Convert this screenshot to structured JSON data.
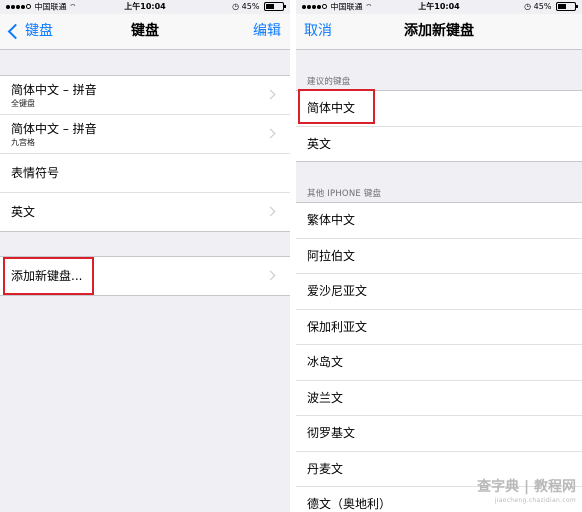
{
  "left_screen": {
    "status": {
      "carrier": "中国联通",
      "time": "上午10:04",
      "battery": "45%"
    },
    "nav": {
      "back_label": "键盘",
      "title": "键盘",
      "edit_label": "编辑"
    },
    "keyboards": [
      {
        "label": "简体中文 – 拼音",
        "sublabel": "全键盘"
      },
      {
        "label": "简体中文 – 拼音",
        "sublabel": "九宫格"
      },
      {
        "label": "表情符号"
      },
      {
        "label": "英文"
      }
    ],
    "add_keyboard_label": "添加新键盘..."
  },
  "right_screen": {
    "status": {
      "carrier": "中国联通",
      "time": "上午10:04",
      "battery": "45%"
    },
    "nav": {
      "cancel_label": "取消",
      "title": "添加新键盘"
    },
    "suggested_header": "建议的键盘",
    "suggested": [
      "简体中文",
      "英文"
    ],
    "other_header": "其他 IPHONE 键盘",
    "others": [
      "繁体中文",
      "阿拉伯文",
      "爱沙尼亚文",
      "保加利亚文",
      "冰岛文",
      "波兰文",
      "彻罗基文",
      "丹麦文",
      "德文（奥地利）"
    ]
  },
  "watermark": {
    "text": "查字典 | 教程网",
    "sub": "jiaocheng.chazidian.com"
  },
  "colors": {
    "ios_blue": "#0a7aff",
    "highlight_red": "#d8212a",
    "group_bg": "#efeff4"
  }
}
